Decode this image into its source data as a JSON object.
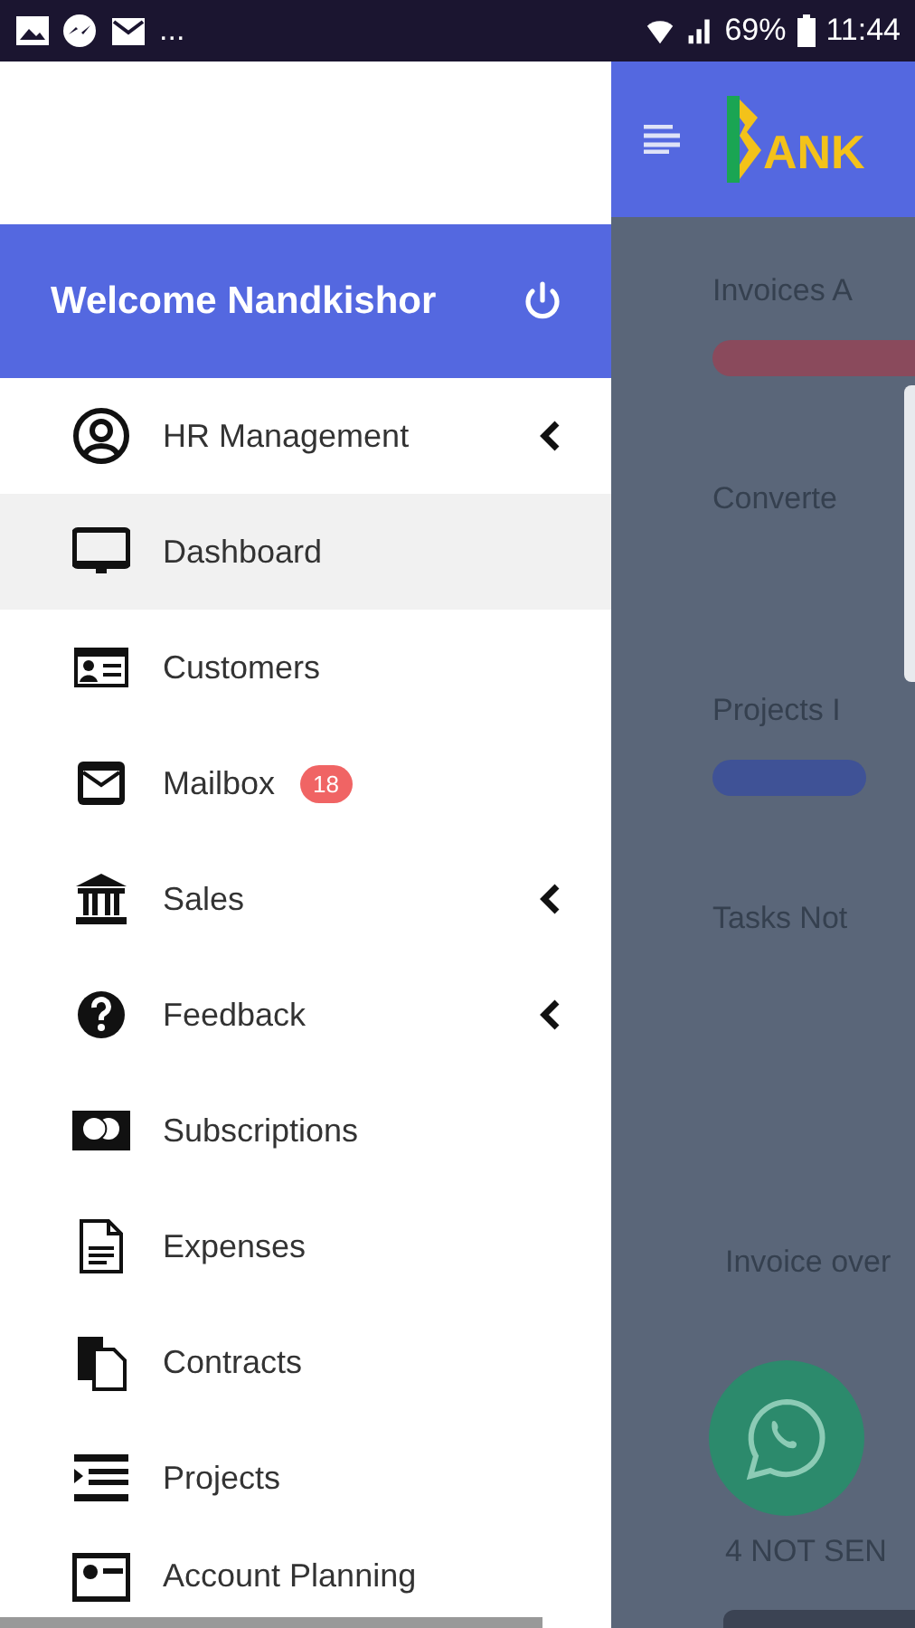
{
  "status_bar": {
    "more": "...",
    "battery": "69%",
    "time": "11:44"
  },
  "background_page": {
    "logo_text": "ANK",
    "items": [
      {
        "kind": "heading",
        "text": "Invoices A"
      },
      {
        "kind": "bar",
        "color": "#8a4a5c"
      },
      {
        "kind": "heading",
        "text": "Converte"
      },
      {
        "kind": "heading",
        "text": "Projects I"
      },
      {
        "kind": "bar",
        "color": "#3f5296"
      },
      {
        "kind": "heading",
        "text": "Tasks Not"
      },
      {
        "kind": "text",
        "text": "Invoice over"
      },
      {
        "kind": "text",
        "text": "4 NOT SEN"
      }
    ]
  },
  "drawer": {
    "welcome": "Welcome Nandkishor",
    "items": [
      {
        "label": "HR Management",
        "selected": false,
        "submenu": true
      },
      {
        "label": "Dashboard",
        "selected": true,
        "submenu": false
      },
      {
        "label": "Customers",
        "selected": false,
        "submenu": false
      },
      {
        "label": "Mailbox",
        "selected": false,
        "submenu": false,
        "badge": "18"
      },
      {
        "label": "Sales",
        "selected": false,
        "submenu": true
      },
      {
        "label": "Feedback",
        "selected": false,
        "submenu": true
      },
      {
        "label": "Subscriptions",
        "selected": false,
        "submenu": false
      },
      {
        "label": "Expenses",
        "selected": false,
        "submenu": false
      },
      {
        "label": "Contracts",
        "selected": false,
        "submenu": false
      },
      {
        "label": "Projects",
        "selected": false,
        "submenu": false
      },
      {
        "label": "Account Planning",
        "selected": false,
        "submenu": false
      }
    ]
  }
}
